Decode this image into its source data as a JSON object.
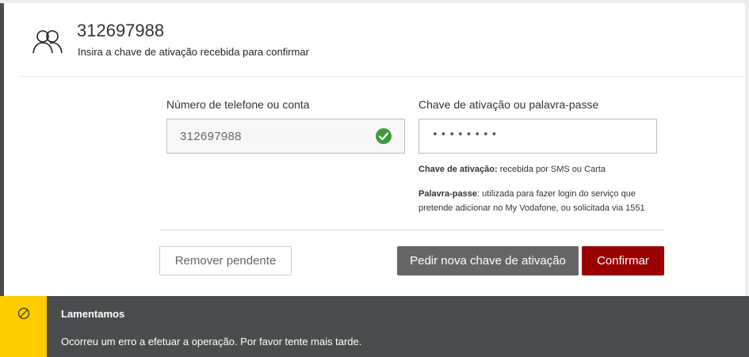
{
  "header": {
    "account_number": "312697988",
    "subtitle": "Insira a chave de ativação recebida para confirmar",
    "icon": "users-icon"
  },
  "form": {
    "phone_label": "Número de telefone ou conta",
    "phone_value": "312697988",
    "phone_status_icon": "check-icon",
    "key_label": "Chave de ativação ou palavra-passe",
    "key_value_masked": "••••••••",
    "help_key_term": "Chave de ativação:",
    "help_key_text": " recebida por SMS ou Carta",
    "help_password_term": "Palavra-passe",
    "help_password_text_1": ": utilizada para fazer login do serviço que",
    "help_password_text_2": "pretende adicionar no My Vodafone, ou solicitada via 1551"
  },
  "actions": {
    "remove_label": "Remover pendente",
    "new_key_label": "Pedir nova chave de ativação",
    "confirm_label": "Confirmar"
  },
  "alert": {
    "icon": "prohibited-icon",
    "title": "Lamentamos",
    "message": "Ocorreu um erro a efetuar a operação. Por favor tente mais tarde."
  },
  "colors": {
    "brand_red": "#990000",
    "alert_yellow": "#fecb00",
    "alert_bg": "#4a4d4e",
    "success_green": "#3c9a3c"
  }
}
